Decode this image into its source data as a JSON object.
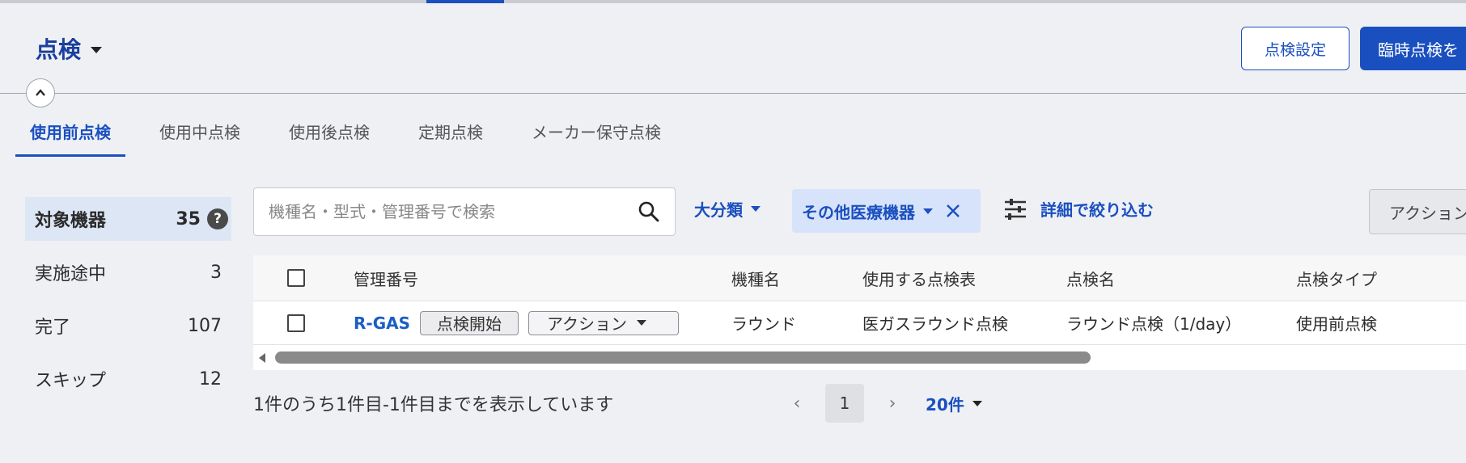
{
  "header": {
    "title": "点検",
    "settings_button": "点検設定",
    "adhoc_button": "臨時点検を"
  },
  "tabs": [
    {
      "label": "使用前点検",
      "active": true
    },
    {
      "label": "使用中点検",
      "active": false
    },
    {
      "label": "使用後点検",
      "active": false
    },
    {
      "label": "定期点検",
      "active": false
    },
    {
      "label": "メーカー保守点検",
      "active": false
    }
  ],
  "sidebar": {
    "items": [
      {
        "label": "対象機器",
        "count": "35",
        "active": true
      },
      {
        "label": "実施途中",
        "count": "3",
        "active": false
      },
      {
        "label": "完了",
        "count": "107",
        "active": false
      },
      {
        "label": "スキップ",
        "count": "12",
        "active": false
      }
    ],
    "help_glyph": "?"
  },
  "toolbar": {
    "search_placeholder": "機種名・型式・管理番号で検索",
    "category_filter": "大分類",
    "active_chip": "その他医療機器",
    "detail_filter": "詳細で絞り込む",
    "action_button": "アクション"
  },
  "table": {
    "columns": [
      "管理番号",
      "機種名",
      "使用する点検表",
      "点検名",
      "点検タイプ"
    ],
    "rows": [
      {
        "id": "R-GAS",
        "start_button": "点検開始",
        "action_button": "アクション",
        "model": "ラウンド",
        "checklist": "医ガスラウンド点検",
        "inspection_name": "ラウンド点検（1/day）",
        "inspection_type": "使用前点検"
      }
    ]
  },
  "pagination": {
    "summary": "1件のうち1件目-1件目までを表示しています",
    "current_page": "1",
    "per_page": "20件"
  },
  "colors": {
    "accent": "#1a4fbf",
    "background": "#eff0f4",
    "chip_background": "#d6e3fa"
  }
}
